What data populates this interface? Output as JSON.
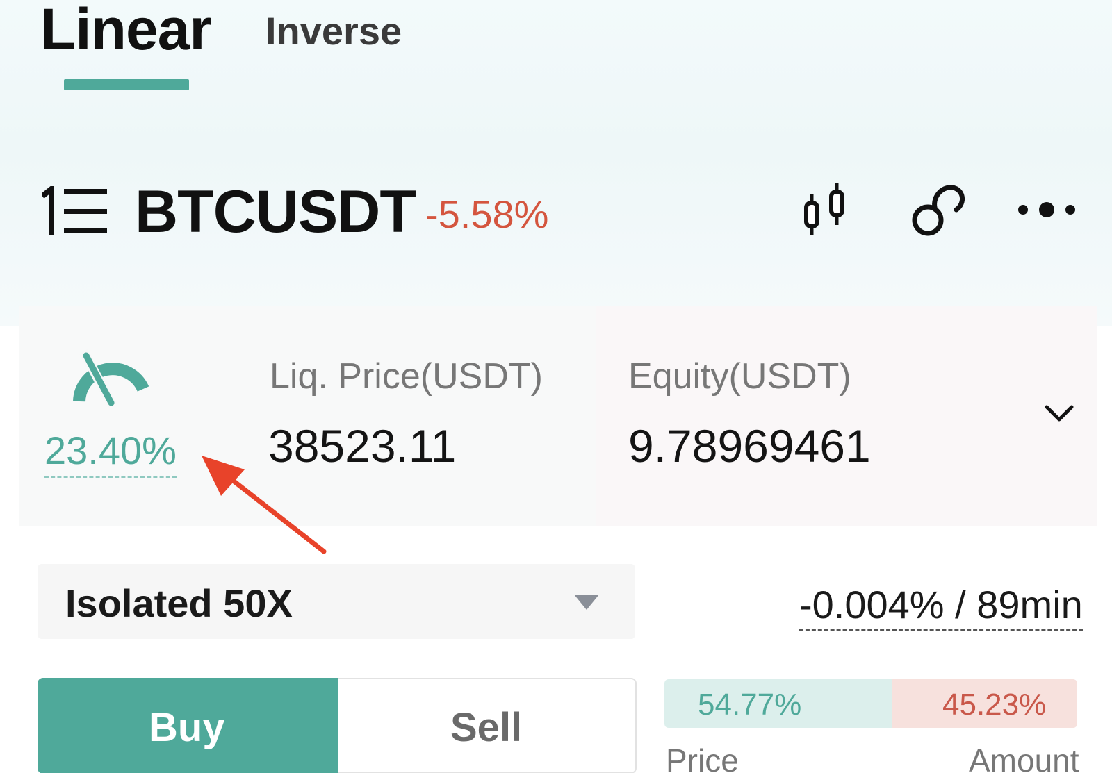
{
  "tabs": {
    "linear": "Linear",
    "inverse": "Inverse",
    "active": "Linear"
  },
  "header": {
    "symbol": "BTCUSDT",
    "change": "-5.58%",
    "icons": [
      "menu-icon",
      "candlestick-chart-icon",
      "link-icon",
      "more-icon"
    ]
  },
  "info": {
    "margin_ratio": "23.40%",
    "liq_price_label": "Liq. Price(USDT)",
    "liq_price_value": "38523.11",
    "equity_label": "Equity(USDT)",
    "equity_value": "9.78969461"
  },
  "order": {
    "margin_mode": "Isolated 50X",
    "funding": "-0.004% / 89min",
    "buy_label": "Buy",
    "sell_label": "Sell",
    "active_side": "Buy"
  },
  "orderbook": {
    "buy_ratio": "54.77%",
    "sell_ratio": "45.23%",
    "price_header": "Price",
    "amount_header": "Amount"
  },
  "colors": {
    "accent": "#4fa99a",
    "negative": "#d4553e",
    "annotation_arrow": "#e8432a"
  }
}
